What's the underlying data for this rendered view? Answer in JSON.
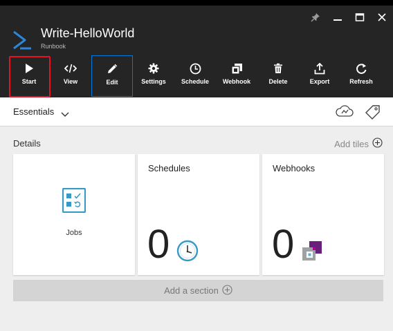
{
  "window": {
    "controls": [
      {
        "name": "pin-icon"
      },
      {
        "name": "minimize-icon"
      },
      {
        "name": "maximize-icon"
      },
      {
        "name": "close-icon"
      }
    ]
  },
  "blade": {
    "title": "Write-HelloWorld",
    "subtitle": "Runbook",
    "logo_icon": "powershell-runbook-icon",
    "accent_color": "#0078d7"
  },
  "toolbar": {
    "commands": [
      {
        "label": "Start",
        "icon": "play-icon"
      },
      {
        "label": "View",
        "icon": "code-icon"
      },
      {
        "label": "Edit",
        "icon": "pencil-icon"
      },
      {
        "label": "Settings",
        "icon": "gear-icon"
      },
      {
        "label": "Schedule",
        "icon": "clock-icon"
      },
      {
        "label": "Webhook",
        "icon": "webhook-icon"
      },
      {
        "label": "Delete",
        "icon": "trash-icon"
      },
      {
        "label": "Export",
        "icon": "export-icon"
      },
      {
        "label": "Refresh",
        "icon": "refresh-icon"
      }
    ],
    "selected": "Edit",
    "highlighted": "Start",
    "highlight_color": "#e81123"
  },
  "essentials": {
    "label": "Essentials",
    "icons": [
      "cloud-icon",
      "tag-icon"
    ]
  },
  "details": {
    "heading": "Details",
    "add_tiles": "Add tiles",
    "tiles": {
      "jobs": {
        "label": "Jobs"
      },
      "schedules": {
        "title": "Schedules",
        "count": "0"
      },
      "webhooks": {
        "title": "Webhooks",
        "count": "0"
      }
    },
    "add_section": "Add a section"
  }
}
